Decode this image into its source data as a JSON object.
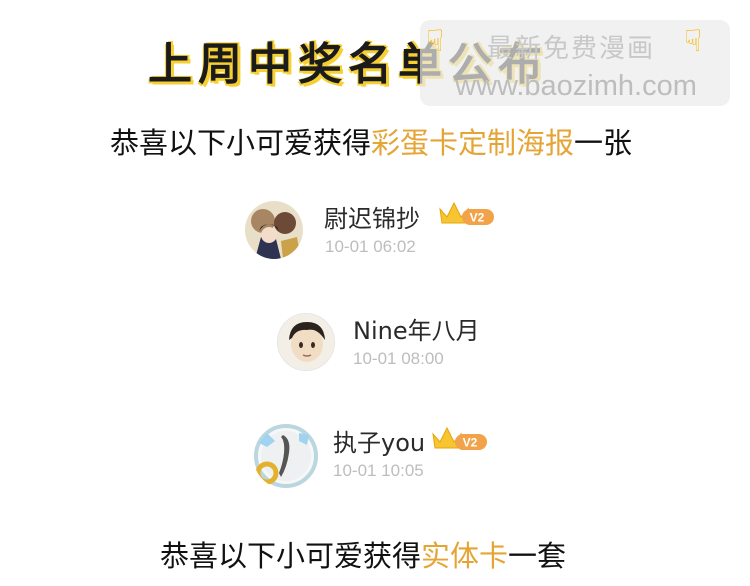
{
  "title": "上周中奖名单公布",
  "watermark": {
    "line1": "最新免费漫画",
    "line2": "www.baozimh.com"
  },
  "section1": {
    "prefix": "恭喜以下小可爱获得",
    "highlight": "彩蛋卡定制海报",
    "suffix": "一张"
  },
  "winners": [
    {
      "name": "尉迟锦抄",
      "time": "10-01 06:02",
      "badge": "V2"
    },
    {
      "name": "Nine年八月",
      "time": "10-01 08:00",
      "badge": ""
    },
    {
      "name": "执子you",
      "time": "10-01 10:05",
      "badge": "V2"
    }
  ],
  "section2": {
    "prefix": "恭喜以下小可爱获得",
    "highlight": "实体卡",
    "suffix": "一套"
  },
  "colors": {
    "highlight": "#e5a536",
    "title_shadow": "#f6cf32",
    "badge": "#f2a34a",
    "crown": "#f7c531"
  }
}
